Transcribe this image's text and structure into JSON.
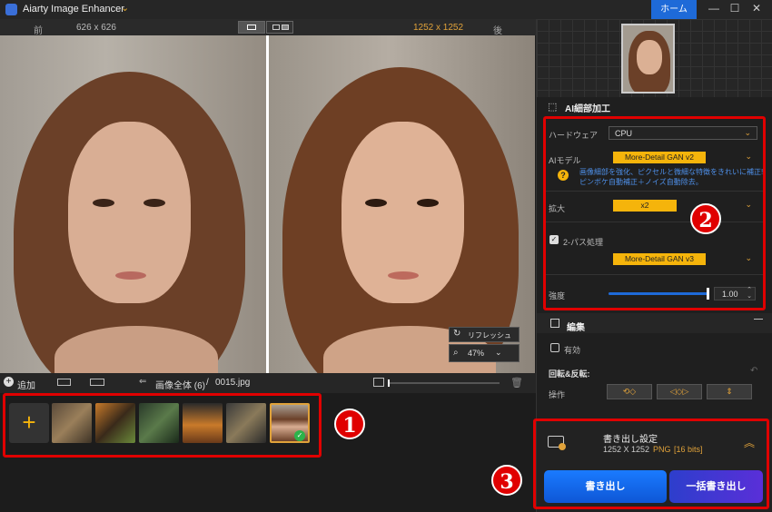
{
  "app": {
    "title": "Aiarty Image Enhancer",
    "home_label": "ホーム"
  },
  "compare": {
    "before_label": "前",
    "after_label": "後",
    "before_size": "626 x 626",
    "after_size": "1252 x 1252"
  },
  "viewer": {
    "refresh_label": "リフレッシュ",
    "zoom": "47%"
  },
  "toolbar": {
    "add_label": "追加",
    "breadcrumb_all": "画像全体 (6)",
    "separator": "/",
    "file_name": "0015.jpg"
  },
  "thumbnails": [
    "butterfly",
    "tiger",
    "forest",
    "burger",
    "lion",
    "portrait"
  ],
  "panel": {
    "ai_detail_title": "AI細部加工",
    "hardware_label": "ハードウェア",
    "hardware_value": "CPU",
    "ai_model_label": "AIモデル",
    "ai_model_value": "More-Detail GAN  v2",
    "model_desc_line1": "画像細部を強化、ピクセルと微細な特徴をきれいに補正!",
    "model_desc_line2": "ピンボケ自動補正＋ノイズ自動除去。",
    "scale_label": "拡大",
    "scale_value": "x2",
    "two_pass_label": "2-パス処理",
    "two_pass_value": "More-Detail GAN  v3",
    "strength_label": "強度",
    "strength_value": "1.00",
    "strength_fraction": 1.0,
    "edit_title": "編集",
    "enable_label": "有効",
    "rotate_label": "回転&反転:",
    "operation_label": "操作",
    "export_title": "書き出し設定",
    "export_size": "1252 X 1252",
    "export_format": "PNG",
    "export_bits": "[16 bits]",
    "export_button": "書き出し",
    "batch_button": "一括書き出し"
  },
  "badges": {
    "one": "1",
    "two": "2",
    "three": "3"
  },
  "colors": {
    "accent_blue": "#1e6ad8",
    "accent_yellow": "#f5b40b",
    "annotation_red": "#e00000"
  }
}
